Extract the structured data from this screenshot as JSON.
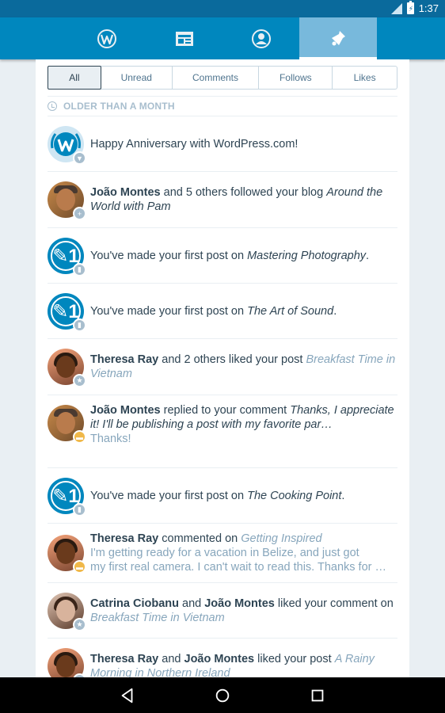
{
  "status_bar": {
    "time": "1:37"
  },
  "tabs": [
    {
      "name": "my-sites",
      "icon": "wordpress-icon"
    },
    {
      "name": "reader",
      "icon": "reader-icon"
    },
    {
      "name": "me",
      "icon": "person-icon"
    },
    {
      "name": "notifications",
      "icon": "bell-icon",
      "active": true
    }
  ],
  "filters": [
    "All",
    "Unread",
    "Comments",
    "Follows",
    "Likes"
  ],
  "section_header": "OLDER THAN A MONTH",
  "notes": [
    {
      "text": "Happy Anniversary with WordPress.com!"
    },
    {
      "actor": "João Montes",
      "text": " and 5 others followed your blog ",
      "target": "Around the World with Pam"
    },
    {
      "text": "You've made your first post on ",
      "target": "Mastering Photography",
      "end": "."
    },
    {
      "text": "You've made your first post on ",
      "target": "The Art of Sound",
      "end": "."
    },
    {
      "actor": "Theresa Ray",
      "text": " and 2 others liked your post ",
      "target": "Breakfast Time in Vietnam"
    },
    {
      "actor": "João Montes",
      "text": " replied to your comment ",
      "target": "Thanks, I appreciate it! I'll be publishing a post with my favorite par…",
      "excerpt": "Thanks!"
    },
    {
      "text": "You've made your first post on ",
      "target": "The Cooking Point",
      "end": "."
    },
    {
      "actor": "Theresa Ray",
      "text": " commented on ",
      "target": "Getting Inspired",
      "excerpt_1": "I'm getting ready for a vacation in Belize, and just got",
      "excerpt_2": "my first real camera. I can't wait to read this. Thanks for …"
    },
    {
      "actor": "Catrina Ciobanu",
      "mid": " and ",
      "actor2": "João Montes",
      "text": " liked your comment on ",
      "target": "Breakfast Time in Vietnam"
    },
    {
      "actor": "Theresa Ray",
      "mid": " and ",
      "actor2": "João Montes",
      "text": " liked your post ",
      "target": "A Rainy Morning in Northern Ireland"
    }
  ],
  "colors": {
    "brand": "#0087be",
    "status_bar": "#0a6a9c",
    "text": "#2e4453",
    "link": "#87a6bc",
    "badge_orange": "#f0b849",
    "badge_gray": "#a8bece"
  }
}
